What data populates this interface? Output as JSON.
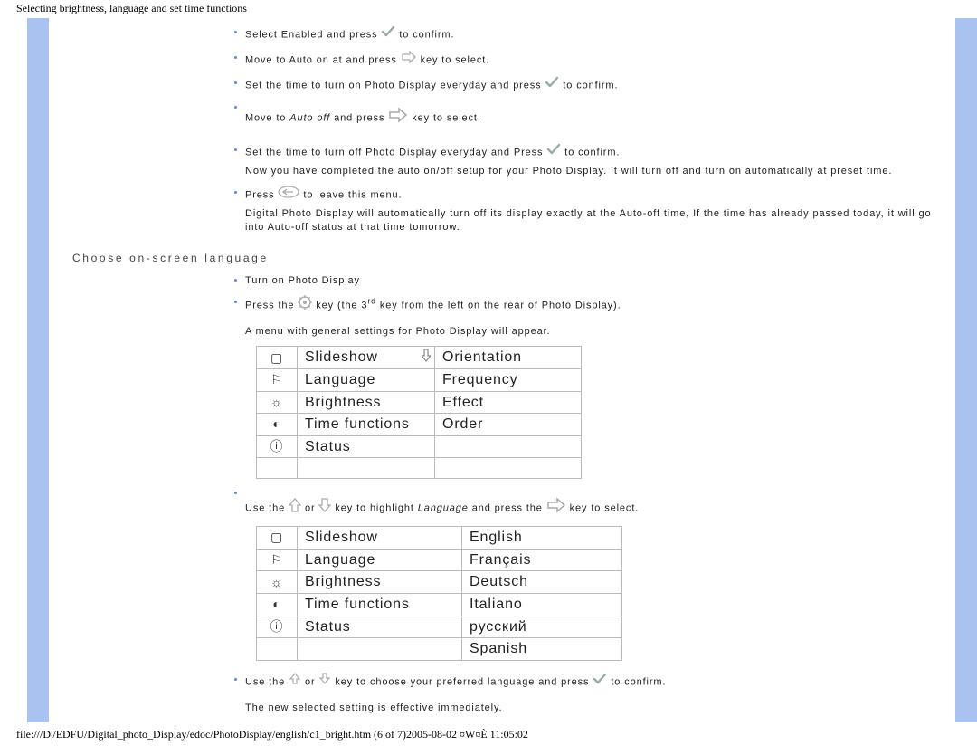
{
  "header": "Selecting brightness, language and set time functions",
  "lines": {
    "l1a": "Select Enabled and press ",
    "l1b": "to confirm.",
    "l2a": "Move to Auto on at and press ",
    "l2b": " key to select.",
    "l3a": "Set the time to turn on Photo Display everyday and press ",
    "l3b": "to confirm.",
    "l4a": "Move to ",
    "l4em": "Auto off",
    "l4b": " and press ",
    "l4c": " key to select.",
    "l5a": "Set the time to turn off Photo Display everyday and Press ",
    "l5b": " to confirm.",
    "l5n": "Now you have completed the auto on/off setup for your Photo Display. It will turn off and turn on automatically at preset time.",
    "l6a": "Press ",
    "l6b": " to leave this menu.",
    "l6n": "Digital Photo Display will automatically turn off its display exactly at the Auto-off time, If the time has already passed today, it will go into Auto-off status at that time tomorrow.",
    "section": "Choose on-screen language",
    "l7": "Turn on Photo Display",
    "l8a": "Press the ",
    "l8b": " key (the 3",
    "l8sup": "rd",
    "l8c": " key from the left on the rear of Photo Display).",
    "l8n": "A menu with general settings for Photo Display will appear.",
    "l9a": "Use the ",
    "l9b": " or ",
    "l9c": " key to highlight ",
    "l9em": "Language",
    "l9d": " and press the ",
    "l9e": " key to select.",
    "l10a": "Use the ",
    "l10b": " or ",
    "l10c": " key to choose your preferred language and press ",
    "l10d": " to confirm.",
    "l10n": "The new selected setting is effective immediately."
  },
  "menu1": [
    [
      "▢",
      "Slideshow",
      "Orientation"
    ],
    [
      "⚐",
      "Language",
      "Frequency"
    ],
    [
      "☼",
      "Brightness",
      "Effect"
    ],
    [
      "◐",
      "Time functions",
      "Order"
    ],
    [
      "ⓘ",
      "Status",
      ""
    ],
    [
      "",
      "",
      ""
    ]
  ],
  "menu2": [
    [
      "▢",
      "Slideshow",
      "English"
    ],
    [
      "⚐",
      "Language",
      "Français"
    ],
    [
      "☼",
      "Brightness",
      "Deutsch"
    ],
    [
      "◐",
      "Time functions",
      "Italiano"
    ],
    [
      "ⓘ",
      "Status",
      "русский"
    ],
    [
      "",
      "",
      "Spanish"
    ]
  ],
  "footer": "file:///D|/EDFU/Digital_photo_Display/edoc/PhotoDisplay/english/c1_bright.htm (6 of 7)2005-08-02 ¤W¤È 11:05:02"
}
